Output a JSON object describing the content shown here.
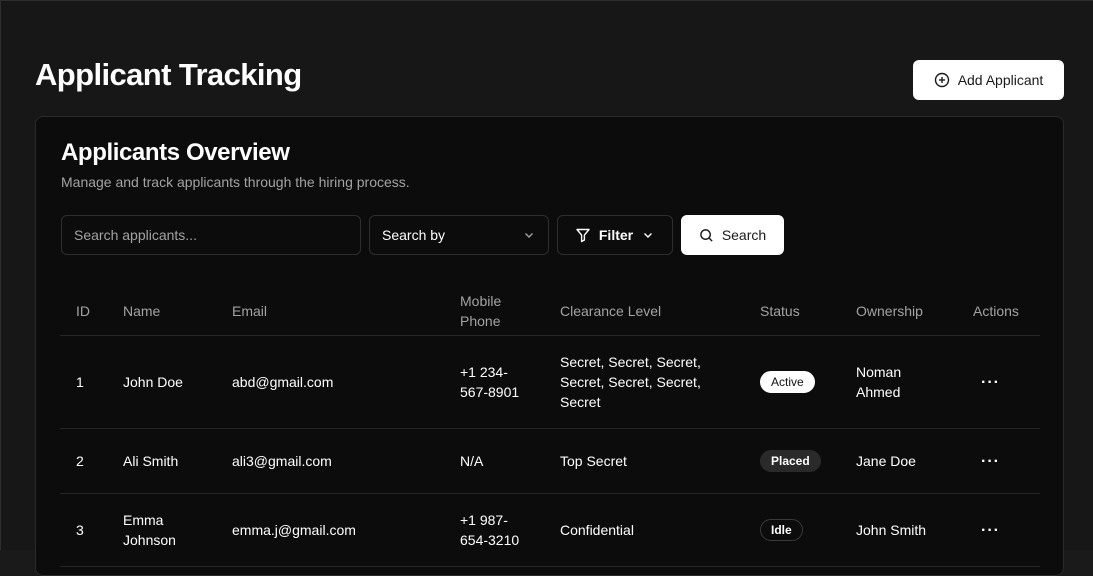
{
  "header": {
    "title": "Applicant Tracking",
    "add_button_label": "Add Applicant",
    "add_icon": "plus-circle-icon"
  },
  "card": {
    "title": "Applicants Overview",
    "subtitle": "Manage and track applicants through the hiring process."
  },
  "toolbar": {
    "search_placeholder": "Search applicants...",
    "search_value": "",
    "search_by_label": "Search by",
    "filter_label": "Filter",
    "search_button_label": "Search",
    "filter_icon": "funnel-icon",
    "search_icon": "magnifier-icon",
    "chevron_icon": "chevron-down-icon"
  },
  "table": {
    "columns": [
      "ID",
      "Name",
      "Email",
      "Mobile Phone",
      "Clearance Level",
      "Status",
      "Ownership",
      "Actions"
    ],
    "rows": [
      {
        "id": "1",
        "name": "John Doe",
        "email": "abd@gmail.com",
        "phone": "+1 234-567-8901",
        "clearance": "Secret, Secret, Secret, Secret, Secret, Secret, Secret",
        "status": "Active",
        "ownership": "Noman Ahmed",
        "actions": "···"
      },
      {
        "id": "2",
        "name": "Ali Smith",
        "email": "ali3@gmail.com",
        "phone": "N/A",
        "clearance": "Top Secret",
        "status": "Placed",
        "ownership": "Jane Doe",
        "actions": "···"
      },
      {
        "id": "3",
        "name": "Emma Johnson",
        "email": "emma.j@gmail.com",
        "phone": "+1 987-654-3210",
        "clearance": "Confidential",
        "status": "Idle",
        "ownership": "John Smith",
        "actions": "···"
      }
    ]
  },
  "colors": {
    "background": "#171717",
    "card": "#0c0c0c",
    "border": "#2a2a2a",
    "primary_button": "#ffffff",
    "muted_text": "#a3a3a3"
  }
}
